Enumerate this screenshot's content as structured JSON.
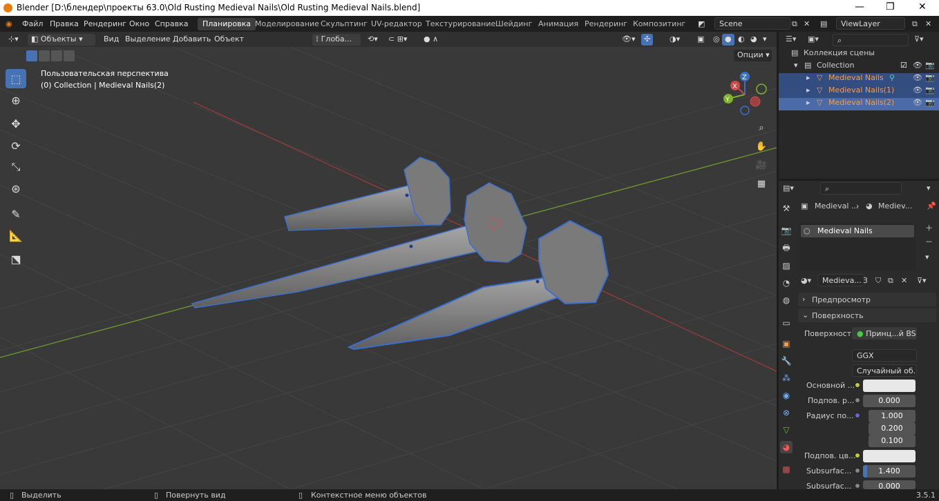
{
  "window": {
    "title": "Blender [D:\\блендер\\проекты 63.0\\Old Rusting Medieval Nails\\Old Rusting Medieval Nails.blend]",
    "min": "—",
    "max": "❐",
    "close": "✕"
  },
  "menu": [
    "Файл",
    "Правка",
    "Рендеринг",
    "Окно",
    "Справка"
  ],
  "workspaces": [
    "Планировка",
    "Моделирование",
    "Скульптинг",
    "UV-редактор",
    "Текстурирование",
    "Шейдинг",
    "Анимация",
    "Рендеринг",
    "Композитинг"
  ],
  "scene": "Scene",
  "view_layer": "ViewLayer",
  "viewport_header": {
    "mode": "Объекты",
    "view": "Вид",
    "select": "Выделение",
    "add": "Добавить",
    "object": "Объект",
    "transform": "Глоба...",
    "options": "Опции"
  },
  "viewport_info": {
    "line1": "Пользовательская перспектива",
    "line2": "(0) Collection | Medieval Nails(2)"
  },
  "gizmo": {
    "x": "X",
    "y": "Y",
    "z": "Z"
  },
  "outliner": {
    "scene_collection": "Коллекция сцены",
    "collection": "Collection",
    "objects": [
      "Medieval Nails",
      "Medieval Nails(1)",
      "Medieval Nails(2)"
    ]
  },
  "properties": {
    "breadcrumb_object": "Medieval ...",
    "breadcrumb_material": "Mediev...",
    "material_slot": "Medieval Nails",
    "material_name": "Medieva...",
    "users": "3",
    "panel_preview": "Предпросмотр",
    "panel_surface": "Поверхность",
    "surface_label": "Поверхность",
    "surface_value": "Принц...й BSDF",
    "distribution": "GGX",
    "subsurface_method": "Случайный об...",
    "rows": [
      {
        "label": "Основной ...",
        "type": "color",
        "color": "#e8e8e8"
      },
      {
        "label": "Подпов. р...",
        "type": "num",
        "value": "0.000"
      },
      {
        "label": "Радиус по...",
        "type": "num",
        "value": "1.000"
      },
      {
        "label": "",
        "type": "num",
        "value": "0.200"
      },
      {
        "label": "",
        "type": "num",
        "value": "0.100"
      },
      {
        "label": "Подпов. цв...",
        "type": "color",
        "color": "#e8e8e8"
      },
      {
        "label": "Subsurfac...",
        "type": "num",
        "value": "1.400"
      },
      {
        "label": "Subsurfac...",
        "type": "num",
        "value": "0.000"
      }
    ]
  },
  "status": {
    "select": "Выделить",
    "rotate": "Повернуть вид",
    "context": "Контекстное меню объектов",
    "version": "3.5.1"
  },
  "colors": {
    "accent": "#4772b3",
    "selected_object": "#f0a050",
    "outline": "#3b6fd0"
  }
}
